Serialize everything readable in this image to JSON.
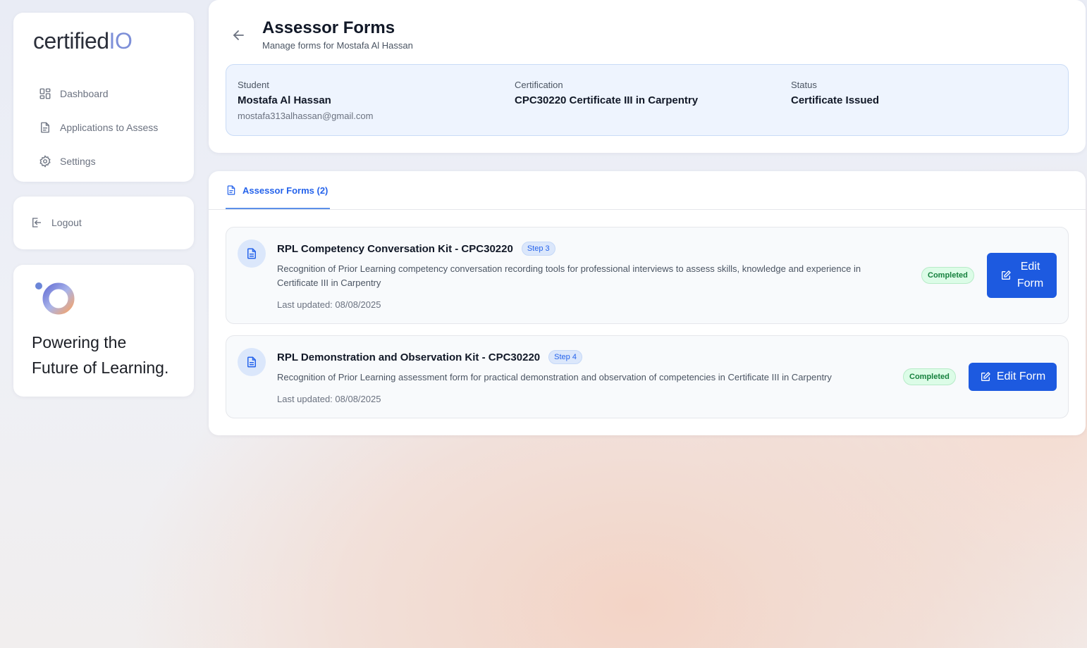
{
  "brand": {
    "name_main": "certified",
    "name_suffix": "IO"
  },
  "sidebar": {
    "items": [
      {
        "label": "Dashboard",
        "icon": "dashboard-icon"
      },
      {
        "label": "Applications to Assess",
        "icon": "document-icon"
      },
      {
        "label": "Settings",
        "icon": "gear-icon"
      }
    ],
    "logout_label": "Logout",
    "promo": {
      "line1": "Powering the",
      "line2": "Future of Learning."
    }
  },
  "header": {
    "title": "Assessor Forms",
    "subtitle": "Manage forms for Mostafa Al Hassan",
    "student_label": "Student",
    "student_name": "Mostafa Al Hassan",
    "student_email": "mostafa313alhassan@gmail.com",
    "certification_label": "Certification",
    "certification_value": "CPC30220 Certificate III in Carpentry",
    "status_label": "Status",
    "status_value": "Certificate Issued"
  },
  "tabs": {
    "forms_label": "Assessor Forms (2)"
  },
  "forms": [
    {
      "title": "RPL Competency Conversation Kit - CPC30220",
      "step": "Step 3",
      "description_line1": "Recognition of Prior Learning competency conversation recording tools for professional interviews to assess skills, knowledge and experience in",
      "description_line2": "Certificate III in Carpentry",
      "updated": "Last updated: 08/08/2025",
      "status": "Completed",
      "button_line1": "Edit",
      "button_line2": "Form"
    },
    {
      "title": "RPL Demonstration and Observation Kit - CPC30220",
      "step": "Step 4",
      "description_line1": "Recognition of Prior Learning assessment form for practical demonstration and observation of competencies in Certificate III in Carpentry",
      "updated": "Last updated: 08/08/2025",
      "status": "Completed",
      "button_label": "Edit Form"
    }
  ],
  "colors": {
    "accent": "#1d5ae0",
    "tab_active": "#2563eb",
    "status_green": "#15803d",
    "info_bg": "#eef4fe"
  }
}
